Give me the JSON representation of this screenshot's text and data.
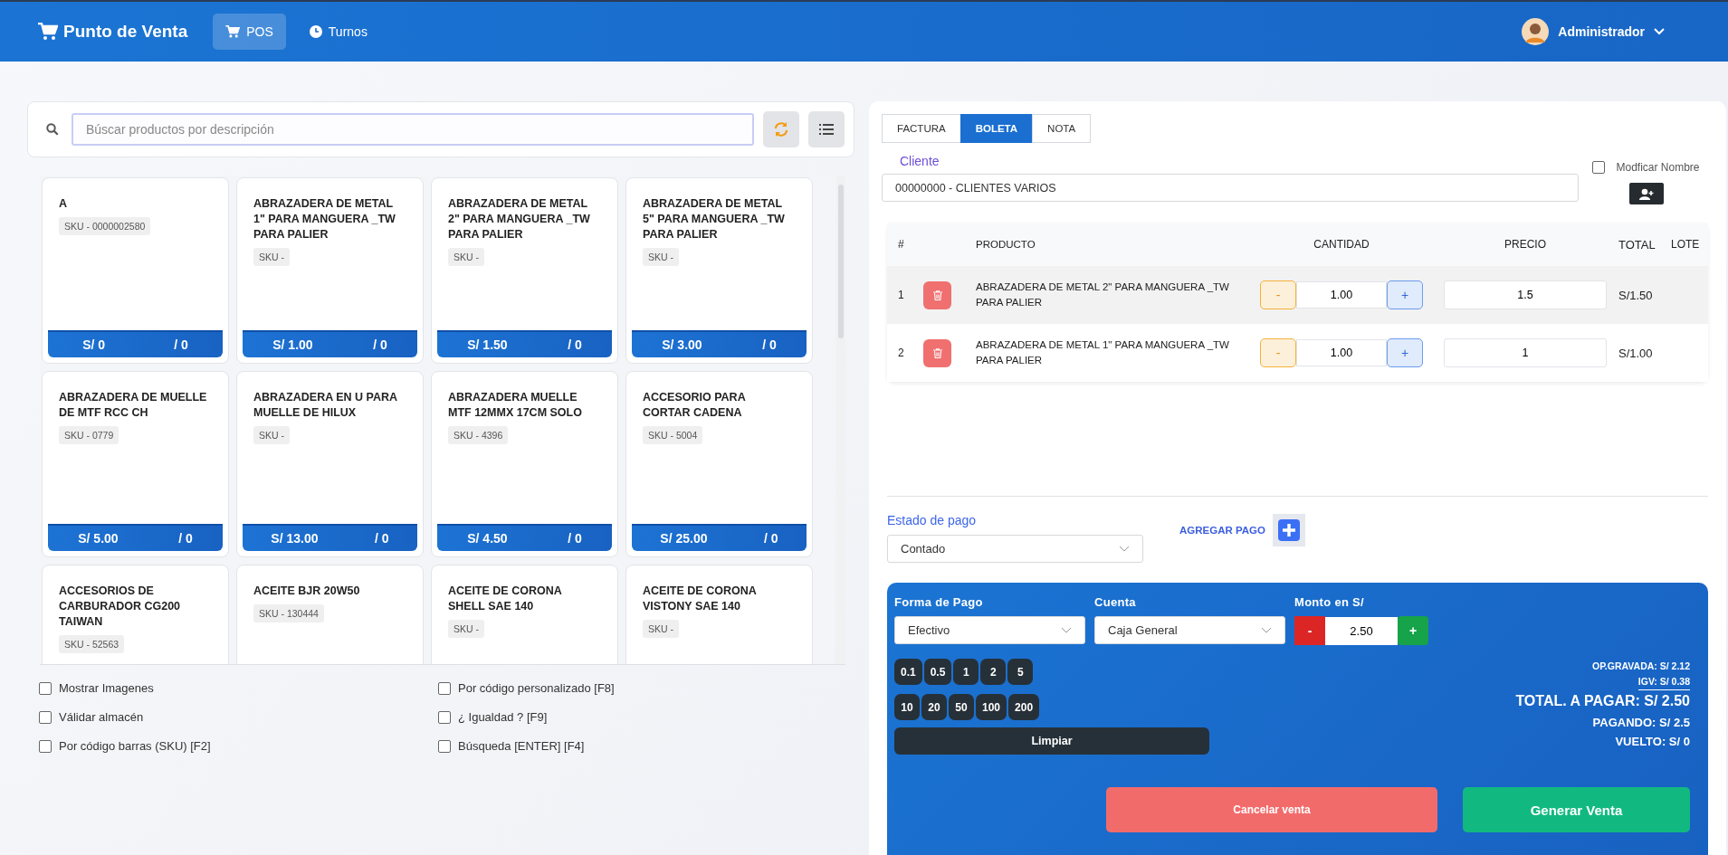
{
  "header": {
    "brand": "Punto de Venta",
    "nav": [
      {
        "label": "POS",
        "selected": true,
        "kind": "cart"
      },
      {
        "label": "Turnos",
        "selected": false,
        "kind": "clock"
      }
    ],
    "user": "Administrador"
  },
  "search": {
    "placeholder": "Búscar productos por descripción"
  },
  "products": [
    {
      "name": "A",
      "sku": "SKU - 0000002580",
      "price": "S/ 0",
      "stock": "/ 0"
    },
    {
      "name": "ABRAZADERA DE METAL 1\" PARA MANGUERA _TW PARA PALIER",
      "sku": "SKU -",
      "price": "S/ 1.00",
      "stock": "/ 0"
    },
    {
      "name": "ABRAZADERA DE METAL 2\" PARA MANGUERA _TW PARA PALIER",
      "sku": "SKU -",
      "price": "S/ 1.50",
      "stock": "/ 0"
    },
    {
      "name": "ABRAZADERA DE METAL 5\" PARA MANGUERA _TW PARA PALIER",
      "sku": "SKU -",
      "price": "S/ 3.00",
      "stock": "/ 0"
    },
    {
      "name": "ABRAZADERA DE MUELLE DE MTF RCC CH",
      "sku": "SKU - 0779",
      "price": "S/ 5.00",
      "stock": "/ 0"
    },
    {
      "name": "ABRAZADERA EN U PARA MUELLE DE HILUX",
      "sku": "SKU -",
      "price": "S/ 13.00",
      "stock": "/ 0"
    },
    {
      "name": "ABRAZADERA MUELLE MTF 12MMX 17CM SOLO",
      "sku": "SKU - 4396",
      "price": "S/ 4.50",
      "stock": "/ 0"
    },
    {
      "name": "ACCESORIO PARA CORTAR CADENA",
      "sku": "SKU - 5004",
      "price": "S/ 25.00",
      "stock": "/ 0"
    },
    {
      "name": "ACCESORIOS DE CARBURADOR CG200 TAIWAN",
      "sku": "SKU - 52563"
    },
    {
      "name": "ACEITE BJR 20W50",
      "sku": "SKU - 130444"
    },
    {
      "name": "ACEITE DE CORONA SHELL SAE 140",
      "sku": "SKU -"
    },
    {
      "name": "ACEITE DE CORONA VISTONY SAE 140",
      "sku": "SKU -"
    }
  ],
  "options": [
    {
      "label": "Mostrar Imagenes",
      "checked": false
    },
    {
      "label": "Por código personalizado [F8]",
      "checked": false
    },
    {
      "label": "Válidar almacén",
      "checked": false
    },
    {
      "label": "¿ Igualdad ? [F9]",
      "checked": false
    },
    {
      "label": "Por código barras (SKU) [F2]",
      "checked": false
    },
    {
      "label": "Búsqueda [ENTER] [F4]",
      "checked": false
    }
  ],
  "doc_tabs": [
    {
      "label": "FACTURA",
      "selected": false
    },
    {
      "label": "BOLETA",
      "selected": true
    },
    {
      "label": "NOTA",
      "selected": false
    }
  ],
  "client": {
    "label": "Cliente",
    "value": "00000000 - CLIENTES VARIOS",
    "modify_name": {
      "label": "Modficar Nombre",
      "checked": false
    }
  },
  "cart": {
    "columns": [
      "#",
      "PRODUCTO",
      "CANTIDAD",
      "PRECIO",
      "TOTAL",
      "LOTE"
    ],
    "rows": [
      {
        "index": "1",
        "product": "ABRAZADERA DE METAL 2\" PARA MANGUERA _TW PARA PALIER",
        "minus": "-",
        "quantity": "1.00",
        "plus": "+",
        "price": "1.5",
        "total": "S/1.50"
      },
      {
        "index": "2",
        "product": "ABRAZADERA DE METAL 1\" PARA MANGUERA _TW PARA PALIER",
        "minus": "-",
        "quantity": "1.00",
        "plus": "+",
        "price": "1",
        "total": "S/1.00"
      }
    ]
  },
  "payment_status": {
    "label": "Estado de pago",
    "value": "Contado",
    "add_label": "AGREGAR PAGO"
  },
  "payment": {
    "method_label": "Forma de Pago",
    "method": "Efectivo",
    "account_label": "Cuenta",
    "account": "Caja General",
    "amount_label": "Monto en S/",
    "minus": "-",
    "amount": "2.50",
    "plus": "+",
    "quick_amounts": [
      [
        "0.1",
        "0.5",
        "1",
        "2",
        "5"
      ],
      [
        "10",
        "20",
        "50",
        "100",
        "200"
      ]
    ],
    "clear": "Limpiar",
    "op_gravada": "OP.GRAVADA: S/ 2.12",
    "igv": "IGV: S/ 0.38",
    "total": "TOTAL. A PAGAR: S/ 2.50",
    "paying": "PAGANDO: S/ 2.5",
    "change": "VUELTO: S/ 0",
    "cancel": "Cancelar venta",
    "generate": "Generar Venta"
  }
}
